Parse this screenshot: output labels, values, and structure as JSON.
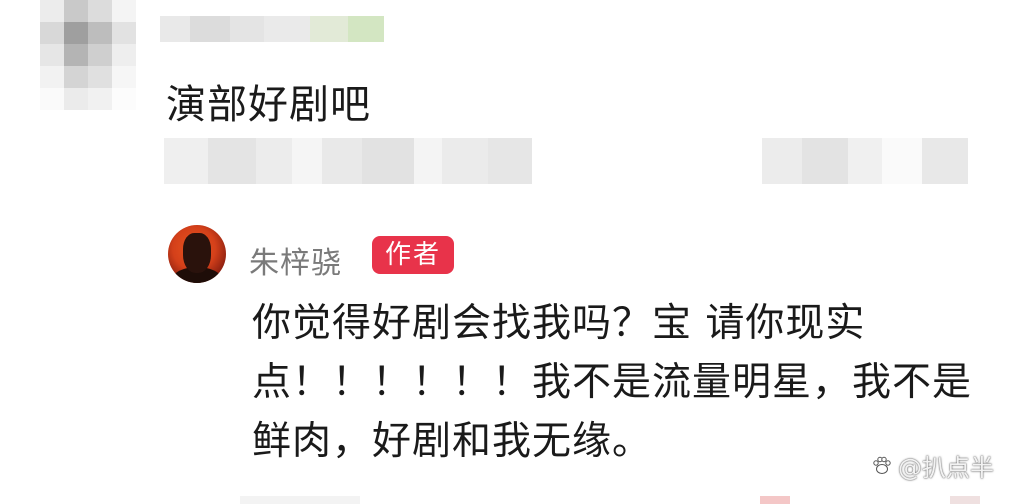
{
  "comment": {
    "text": "演部好剧吧"
  },
  "reply": {
    "author_name": "朱梓骁",
    "author_badge": "作者",
    "lines": [
      "你觉得好剧会找我吗？宝 请你现实",
      "点！！！！！！我不是流量明星，我不是",
      "鲜肉，好剧和我无缘。"
    ]
  },
  "watermark": {
    "text": "@扒点半",
    "icon": "paw-logo-icon"
  },
  "colors": {
    "badge": "#e8334a",
    "name": "#7a7a7a",
    "text": "#1a1a1a"
  }
}
